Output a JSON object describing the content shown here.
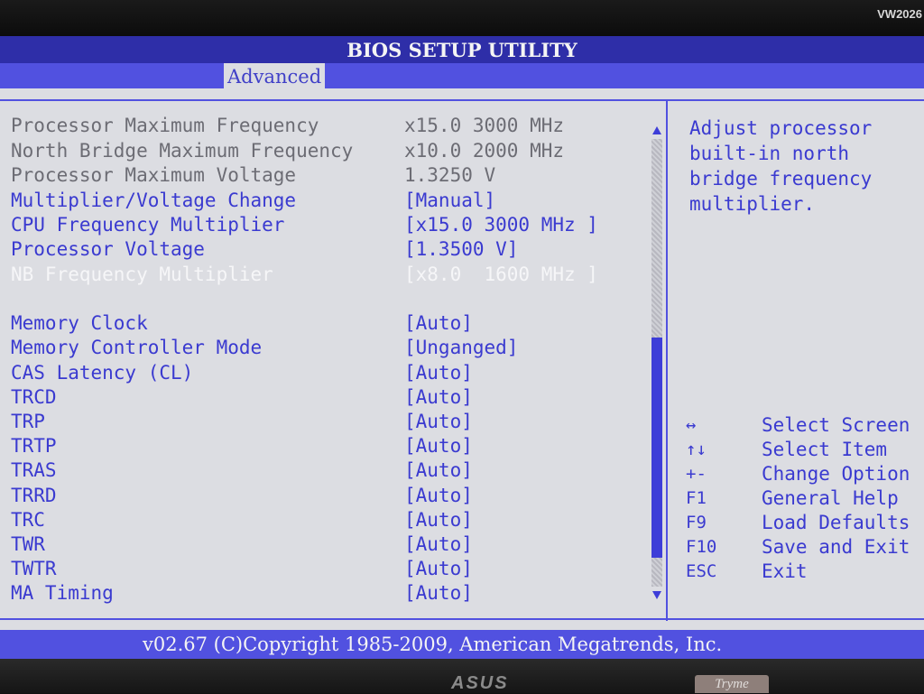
{
  "bezel": {
    "model": "VW2026",
    "brand": "ASUS",
    "badge": "Tryme"
  },
  "title": "BIOS SETUP UTILITY",
  "active_tab": "Advanced",
  "settings": [
    {
      "label": "Processor Maximum Frequency",
      "value": "x15.0 3000 MHz",
      "state": "readonly"
    },
    {
      "label": "North Bridge Maximum Frequency",
      "value": "x10.0 2000 MHz",
      "state": "readonly"
    },
    {
      "label": "Processor Maximum Voltage",
      "value": "1.3250 V",
      "state": "readonly"
    },
    {
      "label": "Multiplier/Voltage Change",
      "value": "[Manual]",
      "state": "editable"
    },
    {
      "label": "CPU Frequency Multiplier",
      "value": "[x15.0 3000 MHz ]",
      "state": "editable"
    },
    {
      "label": "Processor Voltage",
      "value": "[1.3500 V]",
      "state": "editable"
    },
    {
      "label": "NB Frequency Multiplier",
      "value": "[x8.0  1600 MHz ]",
      "state": "selected"
    },
    {
      "label": "Memory Clock",
      "value": "[Auto]",
      "state": "editable"
    },
    {
      "label": "Memory Controller Mode",
      "value": "[Unganged]",
      "state": "editable"
    },
    {
      "label": "CAS Latency (CL)",
      "value": "[Auto]",
      "state": "editable"
    },
    {
      "label": "TRCD",
      "value": "[Auto]",
      "state": "editable"
    },
    {
      "label": "TRP",
      "value": "[Auto]",
      "state": "editable"
    },
    {
      "label": "TRTP",
      "value": "[Auto]",
      "state": "editable"
    },
    {
      "label": "TRAS",
      "value": "[Auto]",
      "state": "editable"
    },
    {
      "label": "TRRD",
      "value": "[Auto]",
      "state": "editable"
    },
    {
      "label": "TRC",
      "value": "[Auto]",
      "state": "editable"
    },
    {
      "label": "TWR",
      "value": "[Auto]",
      "state": "editable"
    },
    {
      "label": "TWTR",
      "value": "[Auto]",
      "state": "editable"
    },
    {
      "label": "MA Timing",
      "value": "[Auto]",
      "state": "editable"
    }
  ],
  "help_text": [
    "Adjust processor",
    "built-in north",
    "bridge frequency",
    "multiplier."
  ],
  "key_help": [
    {
      "key": "↔",
      "desc": "Select Screen"
    },
    {
      "key": "↑↓",
      "desc": "Select Item"
    },
    {
      "key": "+-",
      "desc": "Change Option"
    },
    {
      "key": "F1",
      "desc": "General Help"
    },
    {
      "key": "F9",
      "desc": "Load Defaults"
    },
    {
      "key": "F10",
      "desc": "Save and Exit"
    },
    {
      "key": "ESC",
      "desc": "Exit"
    }
  ],
  "footer": "v02.67 (C)Copyright 1985-2009, American Megatrends, Inc.",
  "colors": {
    "title_bar": "#2e2ea8",
    "accent_blue": "#5151e0",
    "panel_background": "#dcdde2",
    "editable_text": "#3a3ad0",
    "readonly_text": "#6c6c74",
    "selected_text": "#f6f6f8"
  }
}
